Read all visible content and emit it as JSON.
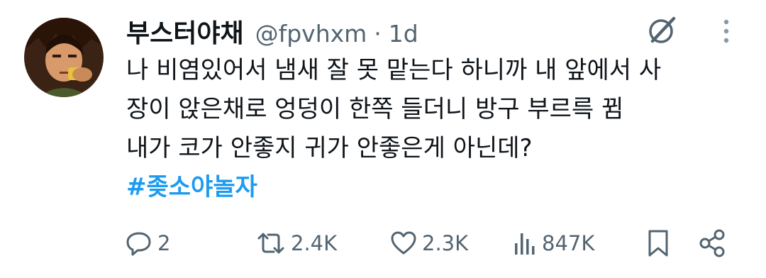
{
  "tweet": {
    "display_name": "부스터야채",
    "handle": "@fpvhxm",
    "separator": "·",
    "time": "1d",
    "body_lines": [
      "나 비염있어서 냄새 잘 못 맡는다 하니까 내 앞에서 사",
      "장이 앉은채로 엉덩이 한쪽 들더니 방구 부르륵 뀜",
      "내가 코가 안좋지 귀가 안좋은게 아닌데?"
    ],
    "hashtag": "#좆소야놀자"
  },
  "actions": {
    "replies": "2",
    "reposts": "2.4K",
    "likes": "2.3K",
    "views": "847K"
  },
  "colors": {
    "text": "#0f1419",
    "secondary": "#536471",
    "accent": "#1d9bf0"
  },
  "icons": {
    "grok": "grok-icon",
    "more": "more-vertical-icon",
    "reply": "reply-icon",
    "repost": "repost-icon",
    "like": "heart-icon",
    "views": "views-chart-icon",
    "bookmark": "bookmark-icon",
    "share": "share-icon"
  }
}
